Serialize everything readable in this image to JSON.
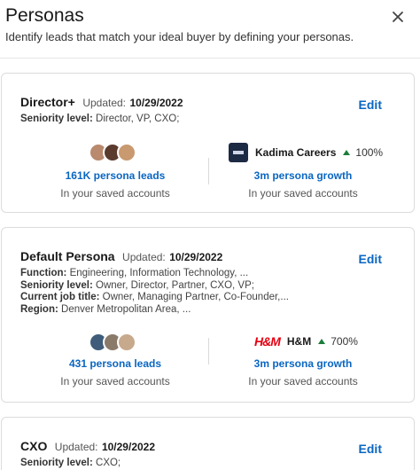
{
  "header": {
    "title": "Personas",
    "subtitle": "Identify leads that match your ideal buyer by defining your personas."
  },
  "personas": [
    {
      "name": "Director+",
      "updated_label": "Updated:",
      "updated_date": "10/29/2022",
      "edit_label": "Edit",
      "details": [
        {
          "key": "Seniority level:",
          "value": "Director, VP, CXO;"
        }
      ],
      "leads": {
        "link": "161K persona leads",
        "sub": "In your saved accounts"
      },
      "company": {
        "name": "Kadima Careers",
        "growth": "100%",
        "logo_icon": "kadima-logo-icon"
      },
      "growth": {
        "link": "3m persona growth",
        "sub": "In your saved accounts"
      }
    },
    {
      "name": "Default Persona",
      "updated_label": "Updated:",
      "updated_date": "10/29/2022",
      "edit_label": "Edit",
      "details": [
        {
          "key": "Function:",
          "value": "Engineering, Information Technology, ..."
        },
        {
          "key": "Seniority level:",
          "value": "Owner, Director, Partner, CXO, VP;"
        },
        {
          "key": "Current job title:",
          "value": "Owner, Managing Partner, Co-Founder,..."
        },
        {
          "key": "Region:",
          "value": "Denver Metropolitan Area, ..."
        }
      ],
      "leads": {
        "link": "431 persona leads",
        "sub": "In your saved accounts"
      },
      "company": {
        "name": "H&M",
        "logo_text": "H&M",
        "growth": "700%"
      },
      "growth": {
        "link": "3m persona growth",
        "sub": "In your saved accounts"
      }
    },
    {
      "name": "CXO",
      "updated_label": "Updated:",
      "updated_date": "10/29/2022",
      "edit_label": "Edit",
      "details": [
        {
          "key": "Seniority level:",
          "value": "CXO;"
        }
      ]
    }
  ],
  "colors": {
    "link": "#0a66c2",
    "growth_up": "#1b7d3a",
    "hm_red": "#e50010"
  }
}
